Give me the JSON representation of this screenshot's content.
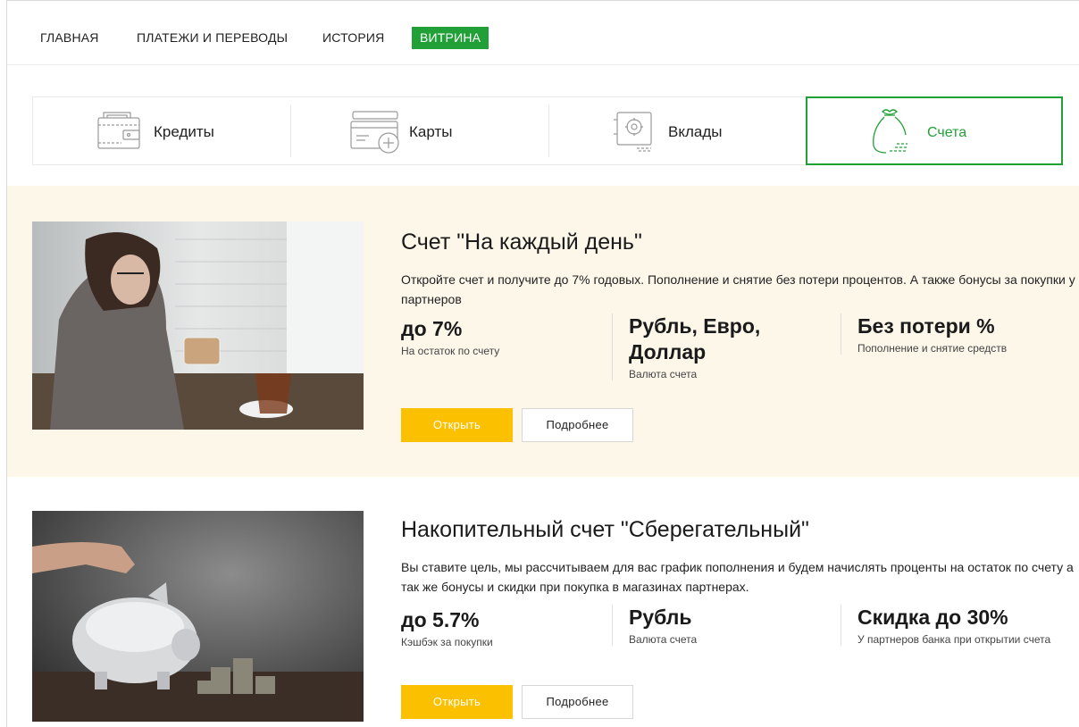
{
  "nav": {
    "items": [
      {
        "label": "ГЛАВНАЯ"
      },
      {
        "label": "ПЛАТЕЖИ И ПЕРЕВОДЫ"
      },
      {
        "label": "ИСТОРИЯ"
      },
      {
        "label": "ВИТРИНА",
        "active": true
      }
    ]
  },
  "categories": [
    {
      "label": "Кредиты",
      "icon": "wallet-icon"
    },
    {
      "label": "Карты",
      "icon": "card-plus-icon"
    },
    {
      "label": "Вклады",
      "icon": "safe-icon"
    },
    {
      "label": "Счета",
      "icon": "money-bag-icon",
      "active": true
    }
  ],
  "products": [
    {
      "title": "Счет \"На каждый день\"",
      "description": "Откройте счет и получите до 7% годовых. Пополнение и снятие без потери процентов. А также бонусы за покупки у партнеров",
      "features": [
        {
          "value": "до 7%",
          "caption": "На остаток по счету"
        },
        {
          "value": "Рубль, Евро, Доллар",
          "caption": "Валюта счета"
        },
        {
          "value": "Без потери %",
          "caption": "Пополнение и снятие средств"
        }
      ],
      "open_label": "Открыть",
      "more_label": "Подробнее"
    },
    {
      "title": "Накопительный счет \"Сберегательный\"",
      "description": "Вы ставите цель, мы рассчитываем для вас график пополнения и будем начислять проценты на остаток по счету а так же бонусы и скидки при покупка в магазинах партнерах.",
      "features": [
        {
          "value": "до 5.7%",
          "caption": "Кэшбэк за покупки"
        },
        {
          "value": "Рубль",
          "caption": "Валюта счета"
        },
        {
          "value": "Скидка до 30%",
          "caption": "У партнеров банка при открытии счета"
        }
      ],
      "open_label": "Открыть",
      "more_label": "Подробнее"
    }
  ],
  "colors": {
    "brand_green": "#21a038",
    "accent_yellow": "#fbc100",
    "promo_beige": "#fdf7ea"
  }
}
